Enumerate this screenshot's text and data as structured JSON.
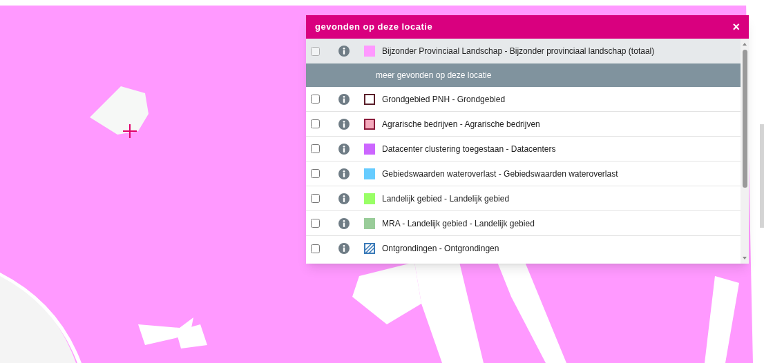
{
  "popup": {
    "title": "gevonden op deze locatie",
    "close": "×",
    "primary": {
      "checked": false,
      "selected": true,
      "swatch": {
        "kind": "fill",
        "color": "#ff99ff"
      },
      "label": "Bijzonder Provinciaal Landschap - Bijzonder provinciaal landschap (totaal)"
    },
    "section_header": "meer gevonden op deze locatie",
    "items": [
      {
        "checked": false,
        "selected": false,
        "swatch": {
          "kind": "outline",
          "color": "#5a1f2a"
        },
        "label": "Grondgebied PNH - Grondgebied"
      },
      {
        "checked": false,
        "selected": false,
        "swatch": {
          "kind": "bordered",
          "color": "#f5a9bc"
        },
        "label": "Agrarische bedrijven - Agrarische bedrijven"
      },
      {
        "checked": false,
        "selected": false,
        "swatch": {
          "kind": "fill",
          "color": "#cc66ff"
        },
        "label": "Datacenter clustering toegestaan - Datacenters"
      },
      {
        "checked": false,
        "selected": false,
        "swatch": {
          "kind": "fill",
          "color": "#66ccff"
        },
        "label": "Gebiedswaarden wateroverlast - Gebiedswaarden wateroverlast"
      },
      {
        "checked": false,
        "selected": false,
        "swatch": {
          "kind": "fill",
          "color": "#99ff66"
        },
        "label": "Landelijk gebied - Landelijk gebied"
      },
      {
        "checked": false,
        "selected": false,
        "swatch": {
          "kind": "fill",
          "color": "#99cc99"
        },
        "label": "MRA - Landelijk gebied - Landelijk gebied"
      },
      {
        "checked": false,
        "selected": false,
        "swatch": {
          "kind": "hatch",
          "color": "#3a7ab8"
        },
        "label": "Ontgrondingen - Ontgrondingen"
      }
    ]
  }
}
